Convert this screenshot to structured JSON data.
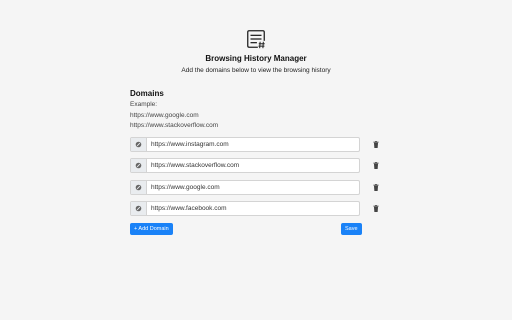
{
  "header": {
    "logo_icon": "list-hash-icon",
    "title": "Browsing History Manager",
    "subtitle": "Add the domains below to view the browsing history"
  },
  "domains": {
    "title": "Domains",
    "example_label": "Example:",
    "examples": [
      "https://www.google.com",
      "https://www.stackoverflow.com"
    ],
    "prefix_icon": "link-icon",
    "delete_icon": "trash-icon",
    "items": [
      {
        "value": "https://www.instagram.com"
      },
      {
        "value": "https://www.stackoverflow.com"
      },
      {
        "value": "https://www.google.com"
      },
      {
        "value": "https://www.facebook.com"
      }
    ]
  },
  "actions": {
    "add_label": "+ Add Domain",
    "save_label": "Save"
  },
  "colors": {
    "background": "#f5f5f5",
    "accent": "#1a82f7",
    "addon_bg": "#e9ecef"
  }
}
